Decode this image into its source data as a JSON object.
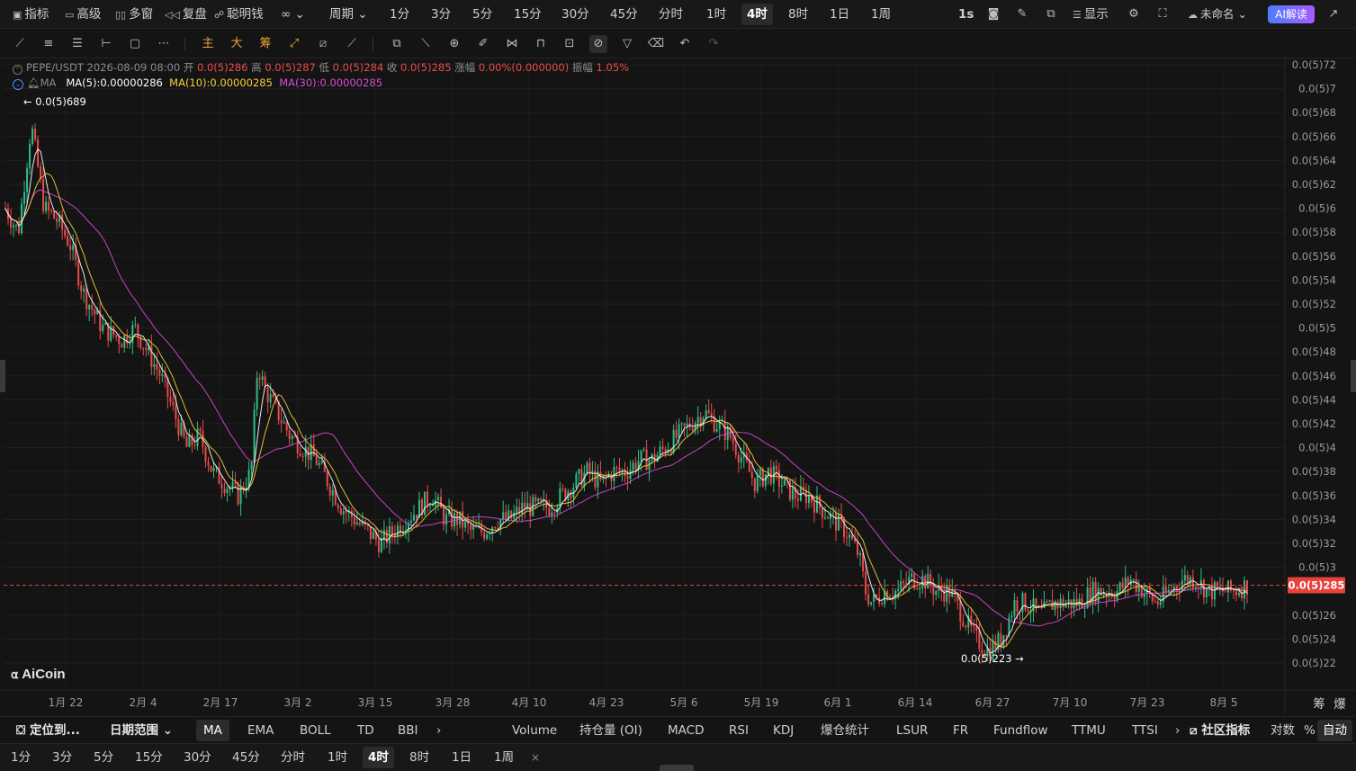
{
  "topbar": {
    "indicators": "指标",
    "advanced": "高级",
    "multi_window": "多窗",
    "replay": "复盘",
    "smart_money": "聪明钱",
    "period_label": "周期",
    "periods": [
      "1分",
      "3分",
      "5分",
      "15分",
      "30分",
      "45分",
      "分时",
      "1时",
      "4时",
      "8时",
      "1日",
      "1周"
    ],
    "active_period": "4时",
    "refresh": "1s",
    "display": "显示",
    "layout_name": "未命名",
    "ai_button": "AI解读"
  },
  "info": {
    "symbol": "PEPE/USDT",
    "datetime": "2026-08-09 08:00",
    "open_label": "开",
    "open": "0.0(5)286",
    "high_label": "高",
    "high": "0.0(5)287",
    "low_label": "低",
    "low": "0.0(5)284",
    "close_label": "收",
    "close": "0.0(5)285",
    "change_label": "涨幅",
    "change": "0.00%(0.000000)",
    "amplitude_label": "振幅",
    "amplitude": "1.05%",
    "ma_name": "MA",
    "ma5": "MA(5):0.00000286",
    "ma10": "MA(10):0.00000285",
    "ma30": "MA(30):0.00000285"
  },
  "chart_data": {
    "type": "candlestick",
    "symbol": "PEPE/USDT",
    "interval": "4h",
    "price_unit_note": "0.0(5)X = 0.00000X",
    "y_ticks": [
      "0.0(5)72",
      "0.0(5)7",
      "0.0(5)68",
      "0.0(5)66",
      "0.0(5)64",
      "0.0(5)62",
      "0.0(5)6",
      "0.0(5)58",
      "0.0(5)56",
      "0.0(5)54",
      "0.0(5)52",
      "0.0(5)5",
      "0.0(5)48",
      "0.0(5)46",
      "0.0(5)44",
      "0.0(5)42",
      "0.0(5)4",
      "0.0(5)38",
      "0.0(5)36",
      "0.0(5)34",
      "0.0(5)32",
      "0.0(5)3",
      "0.0(5)26",
      "0.0(5)24",
      "0.0(5)22"
    ],
    "y_tick_values": [
      7.2e-06,
      7e-06,
      6.8e-06,
      6.6e-06,
      6.4e-06,
      6.2e-06,
      6e-06,
      5.8e-06,
      5.6e-06,
      5.4e-06,
      5.2e-06,
      5e-06,
      4.8e-06,
      4.6e-06,
      4.4e-06,
      4.2e-06,
      4e-06,
      3.8e-06,
      3.6e-06,
      3.4e-06,
      3.2e-06,
      3e-06,
      2.6e-06,
      2.4e-06,
      2.2e-06
    ],
    "ylim": [
      2.1e-06,
      7.3e-06
    ],
    "x_ticks": [
      "1月 22",
      "2月 4",
      "2月 17",
      "3月 2",
      "3月 15",
      "3月 28",
      "4月 10",
      "4月 23",
      "5月 6",
      "5月 19",
      "6月 1",
      "6月 14",
      "6月 27",
      "7月 10",
      "7月 23",
      "8月 5"
    ],
    "last_price_label": "0.0(5)285",
    "last_price": 2.85e-06,
    "max_label": "← 0.0(5)689",
    "min_label": "0.0(5)223 →",
    "price_path": [
      [
        0,
        6e-06
      ],
      [
        2,
        5.8e-06
      ],
      [
        4,
        6.7e-06
      ],
      [
        6,
        6e-06
      ],
      [
        8,
        5.9e-06
      ],
      [
        10,
        5.7e-06
      ],
      [
        12,
        5.3e-06
      ],
      [
        15,
        5e-06
      ],
      [
        18,
        4.9e-06
      ],
      [
        20,
        5e-06
      ],
      [
        22,
        4.8e-06
      ],
      [
        24,
        4.6e-06
      ],
      [
        26,
        4.3e-06
      ],
      [
        28,
        4e-06
      ],
      [
        30,
        4.1e-06
      ],
      [
        32,
        3.8e-06
      ],
      [
        34,
        3.7e-06
      ],
      [
        36,
        3.6e-06
      ],
      [
        38,
        3.8e-06
      ],
      [
        39,
        4.7e-06
      ],
      [
        40,
        4.5e-06
      ],
      [
        42,
        4.3e-06
      ],
      [
        44,
        4.1e-06
      ],
      [
        46,
        4e-06
      ],
      [
        48,
        3.9e-06
      ],
      [
        50,
        3.7e-06
      ],
      [
        52,
        3.5e-06
      ],
      [
        54,
        3.4e-06
      ],
      [
        56,
        3.3e-06
      ],
      [
        58,
        3.2e-06
      ],
      [
        60,
        3.3e-06
      ],
      [
        62,
        3.4e-06
      ],
      [
        64,
        3.5e-06
      ],
      [
        66,
        3.6e-06
      ],
      [
        68,
        3.4e-06
      ],
      [
        70,
        3.4e-06
      ],
      [
        72,
        3.3e-06
      ],
      [
        74,
        3.3e-06
      ],
      [
        76,
        3.4e-06
      ],
      [
        78,
        3.4e-06
      ],
      [
        80,
        3.5e-06
      ],
      [
        82,
        3.5e-06
      ],
      [
        84,
        3.5e-06
      ],
      [
        86,
        3.6e-06
      ],
      [
        88,
        3.7e-06
      ],
      [
        90,
        3.8e-06
      ],
      [
        92,
        3.7e-06
      ],
      [
        94,
        3.8e-06
      ],
      [
        96,
        3.8e-06
      ],
      [
        98,
        3.9e-06
      ],
      [
        100,
        3.9e-06
      ],
      [
        102,
        4e-06
      ],
      [
        104,
        4.1e-06
      ],
      [
        106,
        4.2e-06
      ],
      [
        108,
        4.3e-06
      ],
      [
        110,
        4.2e-06
      ],
      [
        112,
        4.1e-06
      ],
      [
        114,
        3.9e-06
      ],
      [
        116,
        3.7e-06
      ],
      [
        118,
        3.8e-06
      ],
      [
        120,
        3.7e-06
      ],
      [
        122,
        3.6e-06
      ],
      [
        124,
        3.6e-06
      ],
      [
        126,
        3.5e-06
      ],
      [
        128,
        3.4e-06
      ],
      [
        130,
        3.3e-06
      ],
      [
        132,
        3.1e-06
      ],
      [
        133,
        2.8e-06
      ],
      [
        134,
        2.7e-06
      ],
      [
        136,
        2.8e-06
      ],
      [
        138,
        2.8e-06
      ],
      [
        140,
        2.9e-06
      ],
      [
        142,
        2.9e-06
      ],
      [
        144,
        2.8e-06
      ],
      [
        146,
        2.8e-06
      ],
      [
        148,
        2.6e-06
      ],
      [
        150,
        2.4e-06
      ],
      [
        152,
        2.3e-06
      ],
      [
        154,
        2.4e-06
      ],
      [
        156,
        2.7e-06
      ],
      [
        158,
        2.7e-06
      ],
      [
        160,
        2.6e-06
      ],
      [
        162,
        2.7e-06
      ],
      [
        164,
        2.7e-06
      ],
      [
        166,
        2.7e-06
      ],
      [
        168,
        2.8e-06
      ],
      [
        170,
        2.8e-06
      ],
      [
        172,
        2.8e-06
      ],
      [
        174,
        2.9e-06
      ],
      [
        176,
        2.8e-06
      ],
      [
        178,
        2.7e-06
      ],
      [
        180,
        2.8e-06
      ],
      [
        182,
        2.9e-06
      ],
      [
        184,
        2.9e-06
      ],
      [
        186,
        2.8e-06
      ],
      [
        188,
        2.8e-06
      ],
      [
        190,
        2.8e-06
      ],
      [
        192,
        2.85e-06
      ]
    ]
  },
  "indicators_bar": {
    "locate": "定位到...",
    "date_range": "日期范围",
    "main": [
      "MA",
      "EMA",
      "BOLL",
      "TD",
      "BBI"
    ],
    "active_main": "MA",
    "more": "›",
    "sub": [
      "Volume",
      "持仓量 (OI)",
      "MACD",
      "RSI",
      "KDJ",
      "爆仓统计",
      "LSUR",
      "FR",
      "Fundflow",
      "TTMU",
      "TTSI"
    ],
    "community": "社区指标",
    "log_scale": "对数",
    "percent": "%",
    "auto": "自动"
  },
  "side_buttons": {
    "chip": "筹",
    "liquidation": "爆"
  },
  "bottom_periods": [
    "1分",
    "3分",
    "5分",
    "15分",
    "30分",
    "45分",
    "分时",
    "1时",
    "4时",
    "8时",
    "1日",
    "1周"
  ],
  "bottom_active": "4时",
  "bottom_close": "×",
  "logo_text": "AiCoin",
  "colors": {
    "up": "#2ebd85",
    "down": "#ea4a4a",
    "ma5": "#ffffff",
    "ma10": "#f2d23a",
    "ma30": "#d64bd6",
    "last_price": "#e8413c"
  }
}
